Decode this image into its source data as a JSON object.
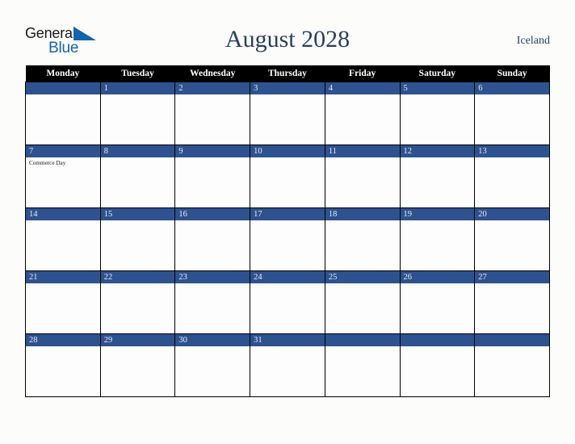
{
  "brand": {
    "name_top": "General",
    "name_bottom": "Blue",
    "triangle_color": "#1464aa",
    "text_color": "#1a1a1a",
    "blue_color": "#1464aa"
  },
  "header": {
    "title": "August 2028",
    "locale": "Iceland",
    "title_color": "#29405f"
  },
  "calendar": {
    "header_background": "#000000",
    "header_text_color": "#ffffff",
    "daybar_background": "#2e5290",
    "daybar_text_color": "#e8ecf4",
    "cell_background": "#fdfdfd",
    "weekdays": [
      "Monday",
      "Tuesday",
      "Wednesday",
      "Thursday",
      "Friday",
      "Saturday",
      "Sunday"
    ],
    "weeks": [
      [
        {
          "day": "",
          "events": []
        },
        {
          "day": "1",
          "events": []
        },
        {
          "day": "2",
          "events": []
        },
        {
          "day": "3",
          "events": []
        },
        {
          "day": "4",
          "events": []
        },
        {
          "day": "5",
          "events": []
        },
        {
          "day": "6",
          "events": []
        }
      ],
      [
        {
          "day": "7",
          "events": [
            "Commerce Day"
          ]
        },
        {
          "day": "8",
          "events": []
        },
        {
          "day": "9",
          "events": []
        },
        {
          "day": "10",
          "events": []
        },
        {
          "day": "11",
          "events": []
        },
        {
          "day": "12",
          "events": []
        },
        {
          "day": "13",
          "events": []
        }
      ],
      [
        {
          "day": "14",
          "events": []
        },
        {
          "day": "15",
          "events": []
        },
        {
          "day": "16",
          "events": []
        },
        {
          "day": "17",
          "events": []
        },
        {
          "day": "18",
          "events": []
        },
        {
          "day": "19",
          "events": []
        },
        {
          "day": "20",
          "events": []
        }
      ],
      [
        {
          "day": "21",
          "events": []
        },
        {
          "day": "22",
          "events": []
        },
        {
          "day": "23",
          "events": []
        },
        {
          "day": "24",
          "events": []
        },
        {
          "day": "25",
          "events": []
        },
        {
          "day": "26",
          "events": []
        },
        {
          "day": "27",
          "events": []
        }
      ],
      [
        {
          "day": "28",
          "events": []
        },
        {
          "day": "29",
          "events": []
        },
        {
          "day": "30",
          "events": []
        },
        {
          "day": "31",
          "events": []
        },
        {
          "day": "",
          "events": []
        },
        {
          "day": "",
          "events": []
        },
        {
          "day": "",
          "events": []
        }
      ]
    ]
  }
}
